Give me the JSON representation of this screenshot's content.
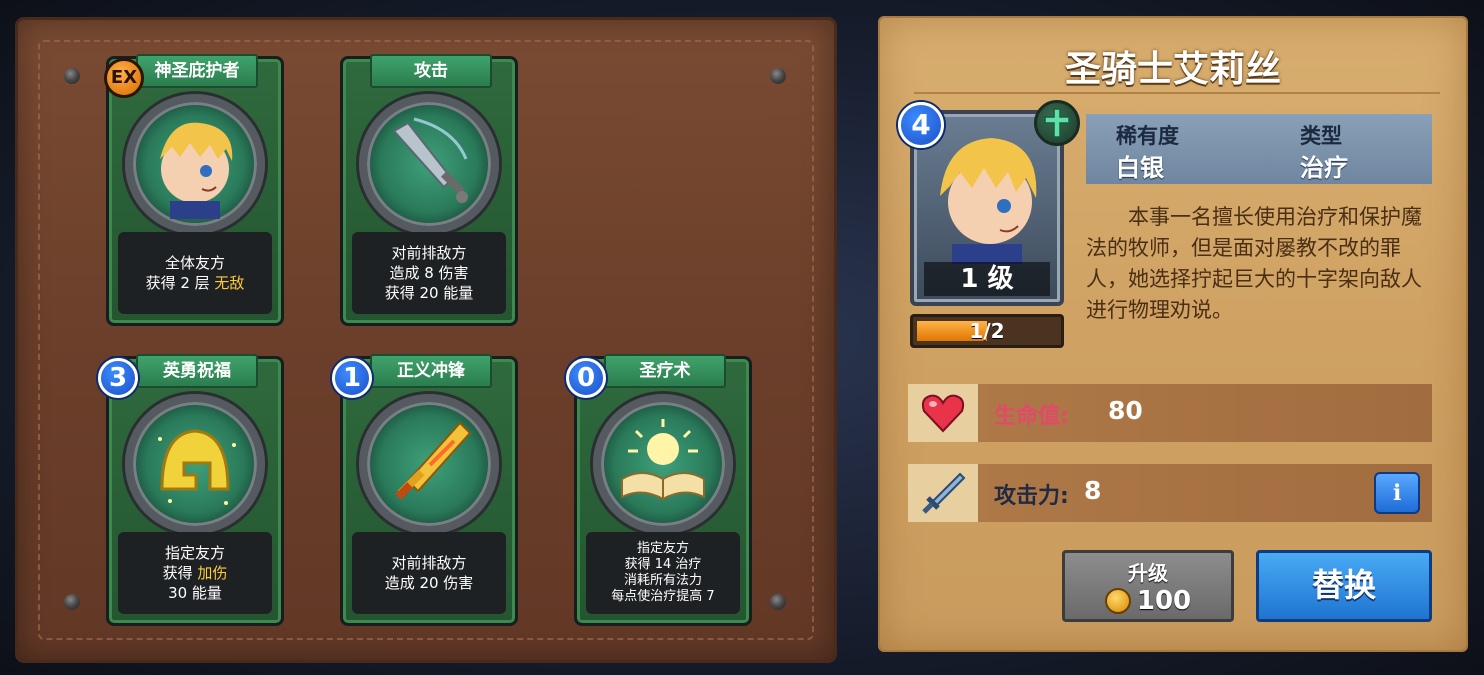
{
  "hero": {
    "name": "圣骑士艾莉丝",
    "star": "4",
    "level_label": "1 级",
    "xp_text": "1/2",
    "xp_progress": 0.5,
    "rarity_label": "稀有度",
    "rarity_value": "白银",
    "type_label": "类型",
    "type_value": "治疗",
    "lore": "本事一名擅长使用治疗和保护魔法的牧师，但是面对屡教不改的罪人，她选择拧起巨大的十字架向敌人进行物理劝说。",
    "hp_label": "生命值:",
    "hp_value": "80",
    "atk_label": "攻击力:",
    "atk_value": "8"
  },
  "buttons": {
    "upgrade_label": "升级",
    "upgrade_cost": "100",
    "replace_label": "替换"
  },
  "cards": [
    {
      "name": "神圣庇护者",
      "badge": "EX",
      "line1": "全体友方",
      "line2": "获得 2 层 ",
      "hl": "无敌"
    },
    {
      "name": "攻击",
      "line1": "对前排敌方",
      "line2": "造成 8 伤害",
      "line3": "获得 20 能量"
    },
    {
      "name": "英勇祝福",
      "cost": "3",
      "line1": "指定友方",
      "line2": "获得 ",
      "hl": "加伤",
      "line3": "30 能量"
    },
    {
      "name": "正义冲锋",
      "cost": "1",
      "line1": "对前排敌方",
      "line2": "造成 20 伤害"
    },
    {
      "name": "圣疗术",
      "cost": "0",
      "line1": "指定友方",
      "line2": "获得 14 治疗",
      "line3": "消耗所有法力",
      "line4": "每点使治疗提高 7"
    }
  ],
  "colors": {
    "hp_label": "#e24a6a",
    "atk_label": "#1f2a44",
    "highlight": "#ffcc33"
  }
}
